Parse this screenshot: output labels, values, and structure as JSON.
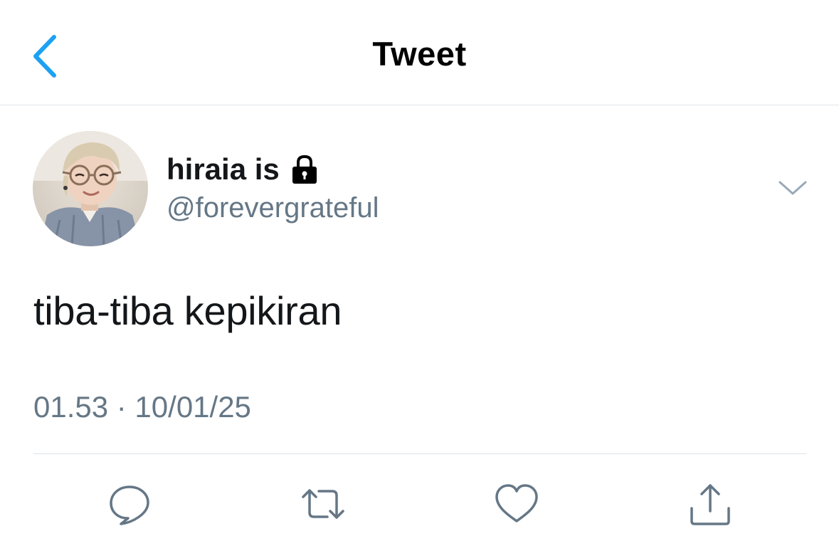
{
  "header": {
    "title": "Tweet",
    "back_icon": "chevron-left-icon",
    "accent_color": "#1da1f2"
  },
  "tweet": {
    "display_name": "hiraia is",
    "protected_icon": "lock-icon",
    "handle": "@forevergrateful",
    "text": "tiba-tiba kepikiran",
    "timestamp": "01.53 · 10/01/25",
    "more_icon": "chevron-down-icon"
  },
  "actions": [
    {
      "name": "reply",
      "icon": "reply-icon"
    },
    {
      "name": "retweet",
      "icon": "retweet-icon"
    },
    {
      "name": "like",
      "icon": "heart-icon"
    },
    {
      "name": "share",
      "icon": "share-icon"
    }
  ],
  "colors": {
    "text_primary": "#14171a",
    "text_secondary": "#657786",
    "divider": "#dfe3e7"
  }
}
